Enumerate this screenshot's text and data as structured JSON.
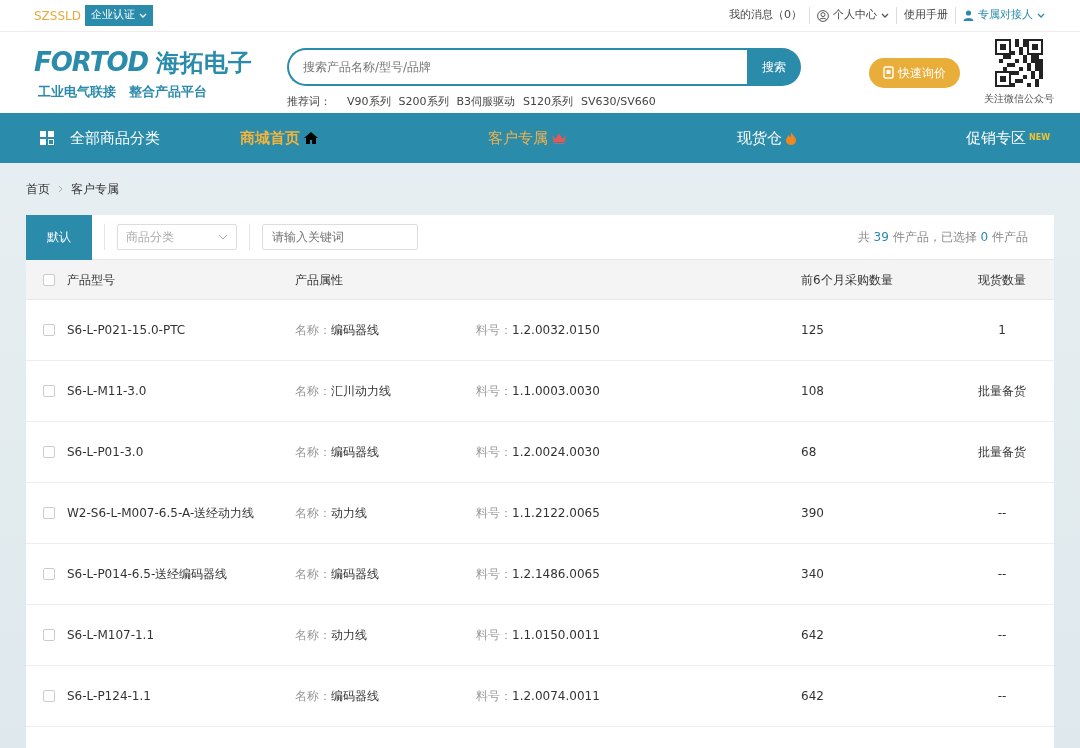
{
  "top_bar": {
    "account": "SZSSLD",
    "certify_button": "企业认证",
    "links": [
      {
        "label": "我的消息（0）",
        "kind": "plain"
      },
      {
        "label": "个人中心",
        "kind": "user-menu"
      },
      {
        "label": "使用手册",
        "kind": "plain"
      },
      {
        "label": "专属对接人",
        "kind": "contact-menu"
      }
    ]
  },
  "header": {
    "logo": {
      "mark": "FORTOD",
      "name": "海拓电子",
      "slogan": "工业电气联接　整合产品平台"
    },
    "search": {
      "placeholder": "搜索产品名称/型号/品牌",
      "button": "搜索"
    },
    "recommend_label": "推荐词：",
    "recommend": [
      "V90系列",
      "S200系列",
      "B3伺服驱动",
      "S120系列",
      "SV630/SV660"
    ],
    "quote_button": "快速询价",
    "qr_caption": "关注微信公众号"
  },
  "nav": {
    "all_categories": "全部商品分类",
    "items": [
      {
        "label": "商城首页",
        "kind": "home",
        "selected": false,
        "highlight": true
      },
      {
        "label": "客户专属",
        "kind": "crown",
        "selected": true,
        "highlight": false
      },
      {
        "label": "现货仓",
        "kind": "fire",
        "selected": false,
        "highlight": false
      },
      {
        "label": "促销专区",
        "kind": "new",
        "badge": "NEW",
        "selected": false,
        "highlight": false
      }
    ]
  },
  "breadcrumb": [
    "首页",
    "客户专属"
  ],
  "toolbar": {
    "sort_tab": "默认",
    "category_placeholder": "商品分类",
    "keyword_placeholder": "请输入关键词",
    "summary": [
      "共",
      "39",
      "件产品，已选择",
      "0",
      "件产品"
    ]
  },
  "table": {
    "columns": [
      "产品型号",
      "产品属性",
      "前6个月采购数量",
      "现货数量"
    ],
    "all_checked": false,
    "rows": [
      {
        "model": "S6-L-P021-15.0-PTC",
        "name_label": "名称：",
        "name": "编码器线",
        "part_label": "料号：",
        "part": "1.2.0032.0150",
        "qty": "125",
        "stock": "1",
        "checked": false
      },
      {
        "model": "S6-L-M11-3.0",
        "name_label": "名称：",
        "name": "汇川动力线",
        "part_label": "料号：",
        "part": "1.1.0003.0030",
        "qty": "108",
        "stock": "批量备货",
        "checked": false
      },
      {
        "model": "S6-L-P01-3.0",
        "name_label": "名称：",
        "name": "编码器线",
        "part_label": "料号：",
        "part": "1.2.0024.0030",
        "qty": "68",
        "stock": "批量备货",
        "checked": false
      },
      {
        "model": "W2-S6-L-M007-6.5-A-送经动力线",
        "name_label": "名称：",
        "name": "动力线",
        "part_label": "料号：",
        "part": "1.1.2122.0065",
        "qty": "390",
        "stock": "--",
        "checked": false
      },
      {
        "model": "S6-L-P014-6.5-送经编码器线",
        "name_label": "名称：",
        "name": "编码器线",
        "part_label": "料号：",
        "part": "1.2.1486.0065",
        "qty": "340",
        "stock": "--",
        "checked": false
      },
      {
        "model": "S6-L-M107-1.1",
        "name_label": "名称：",
        "name": "动力线",
        "part_label": "料号：",
        "part": "1.1.0150.0011",
        "qty": "642",
        "stock": "--",
        "checked": false
      },
      {
        "model": "S6-L-P124-1.1",
        "name_label": "名称：",
        "name": "编码器线",
        "part_label": "料号：",
        "part": "1.2.0074.0011",
        "qty": "642",
        "stock": "--",
        "checked": false
      }
    ]
  }
}
